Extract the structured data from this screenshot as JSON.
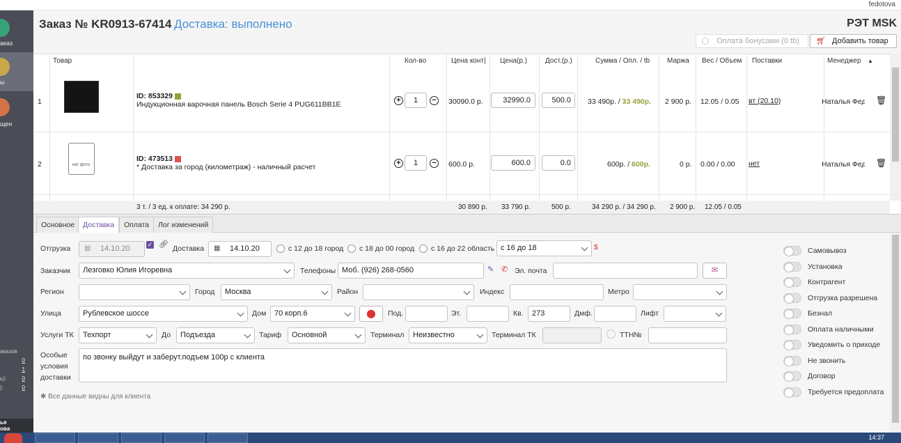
{
  "topbar": {
    "user": "fedotova"
  },
  "sidebar": {
    "items": [
      {
        "label": "аказ",
        "color": "#3aa27a"
      },
      {
        "label": "ы",
        "color": "#c9a74a"
      },
      {
        "label": "щен",
        "color": "#d4724a"
      }
    ],
    "stats": [
      {
        "label": "аказов",
        "value": ""
      },
      {
        "label": "",
        "value": "0"
      },
      {
        "label": "",
        "value": "1"
      },
      {
        "label": "ь):",
        "value": "0"
      },
      {
        "label": "):",
        "value": "0"
      }
    ],
    "user": "ья\nова"
  },
  "header": {
    "title": "Заказ № KR0913-67414",
    "status": "Доставка: выполнено",
    "brand": "РЭТ MSK",
    "bonus_btn": "Оплата бонусами (0 tb)",
    "add_btn": "Добавить товар"
  },
  "table": {
    "columns": [
      "Товар",
      "Кол-во",
      "Цена конт|",
      "Цена(р.)",
      "Дост.(р.)",
      "Сумма / Опл. / tb",
      "Маржа",
      "Вес / Объем",
      "Поставки",
      "Менеджер ("
    ],
    "rows": [
      {
        "num": "1",
        "id": "ID: 853329",
        "name": "Индукционная варочная панель Bosch Serie 4 PUG611BB1E",
        "qty": "1",
        "price_cont": "30090.0 р.",
        "price": "32990.0",
        "delivery": "500.0",
        "sum": "33 490р. /",
        "paid": "33 490р.",
        "margin": "2 900 р.",
        "weight": "12.05 / 0.05",
        "supply": "вт (20.10)",
        "manager": "Наталья Федо",
        "status_color": "#9aa13b"
      },
      {
        "num": "2",
        "id": "ID: 473513",
        "name": "* Доставка за город (километраж) - наличный расчет",
        "qty": "1",
        "price_cont": "600.0 р.",
        "price": "600.0",
        "delivery": "0.0",
        "sum": "600р. /",
        "paid": "600р.",
        "margin": "0 р.",
        "weight": "0.00 / 0.00",
        "supply": "нет",
        "manager": "Наталья Федо",
        "status_color": "#d9534f",
        "no_photo": "нет фото"
      }
    ],
    "footer": {
      "summary": "3 т. / 3 ед. к оплате: 34 290 р.",
      "price_cont": "30 890 р.",
      "price": "33 790 р.",
      "delivery": "500 р.",
      "sum": "34 290 р. / 34 290 р.",
      "margin": "2 900 р.",
      "weight": "12.05 / 0.05"
    }
  },
  "tabs": [
    "Основное",
    "Доставка",
    "Оплата",
    "Лог изменений"
  ],
  "form": {
    "shipment_label": "Отгрузка",
    "shipment_date": "14.10.20",
    "delivery_label": "Доставка",
    "delivery_date": "14.10.20",
    "radios": [
      "с 12 до 18 город",
      "с 18 до 00 город",
      "с 16 до 22 область"
    ],
    "time_slot": "с 16 до 18",
    "currency": "$",
    "customer_label": "Заказчик",
    "customer": "Лезговко Юлия Игоревна",
    "phones_label": "Телефоны",
    "phone": "Моб. (926) 268-0560",
    "email_label": "Эл. почта",
    "email": "",
    "region_label": "Регион",
    "region": "",
    "city_label": "Город",
    "city": "Москва",
    "district_label": "Район",
    "district": "",
    "index_label": "Индекс",
    "index": "",
    "metro_label": "Метро",
    "metro": "",
    "street_label": "Улица",
    "street": "Рублевское шоссе",
    "house_label": "Дом",
    "house": "70 корп.6",
    "entrance_label": "Под.",
    "entrance": "",
    "floor_label": "Эт.",
    "floor": "",
    "apt_label": "Кв.",
    "apt": "273",
    "intercom_label": "Дмф.",
    "intercom": "",
    "lift_label": "Лифт",
    "lift": "",
    "tk_label": "Услуги ТК",
    "tk": "Техпорт",
    "to_label": "До",
    "to": "Подъезда",
    "tariff_label": "Тариф",
    "tariff": "Основной",
    "terminal_label": "Терминал",
    "terminal": "Неизвестно",
    "terminal_tk_label": "Терминал ТК",
    "terminal_tk": "",
    "ttn_label": "ТТН№",
    "ttn": "",
    "notes_label": "Особые\nусловия\nдоставки",
    "notes": "по звонку выйдут и заберут.подъем 100р с клиента",
    "hint": "✱ Все данные видны для клиента"
  },
  "toggles": [
    "Самовывоз",
    "Установка",
    "Контрагент",
    "Отгрузка разрешена",
    "Безнал",
    "Оплата наличными",
    "Уведомить о приходе",
    "Не звонить",
    "Договор",
    "Требуется предоплата"
  ],
  "taskbar": {
    "clock": "14:37"
  }
}
